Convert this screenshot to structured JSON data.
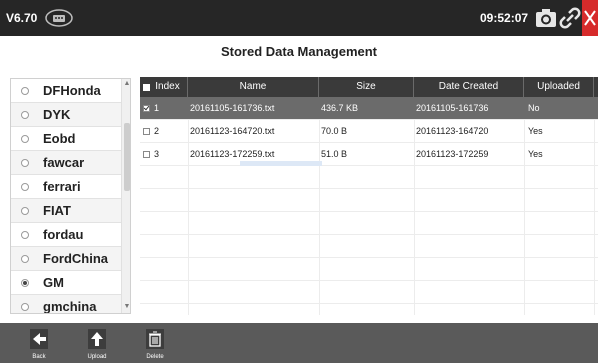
{
  "topbar": {
    "version": "V6.70",
    "time": "09:52:07",
    "icons": [
      "vci-connection-icon",
      "camera-icon",
      "link-icon",
      "close-icon"
    ]
  },
  "page": {
    "title": "Stored Data Management"
  },
  "vehicle_list": {
    "items": [
      {
        "label": "DFHonda",
        "selected": false
      },
      {
        "label": "DYK",
        "selected": false
      },
      {
        "label": "Eobd",
        "selected": false
      },
      {
        "label": "fawcar",
        "selected": false
      },
      {
        "label": "ferrari",
        "selected": false
      },
      {
        "label": "FIAT",
        "selected": false
      },
      {
        "label": "fordau",
        "selected": false
      },
      {
        "label": "FordChina",
        "selected": false
      },
      {
        "label": "GM",
        "selected": true
      },
      {
        "label": "gmchina",
        "selected": false
      }
    ]
  },
  "table": {
    "columns": [
      "Index",
      "Name",
      "Size",
      "Date Created",
      "Uploaded"
    ],
    "rows": [
      {
        "index": "1",
        "name": "20161105-161736.txt",
        "size": "436.7 KB",
        "date": "20161105-161736",
        "uploaded": "No",
        "checked": true,
        "selected": true
      },
      {
        "index": "2",
        "name": "20161123-164720.txt",
        "size": "70.0 B",
        "date": "20161123-164720",
        "uploaded": "Yes",
        "checked": false,
        "selected": false
      },
      {
        "index": "3",
        "name": "20161123-172259.txt",
        "size": "51.0 B",
        "date": "20161123-172259",
        "uploaded": "Yes",
        "checked": false,
        "selected": false
      }
    ]
  },
  "toolbar": {
    "back_label": "Back",
    "upload_label": "Upload",
    "delete_label": "Delete"
  },
  "colors": {
    "topbar": "#262626",
    "close": "#d62b2b",
    "header": "#3a3a3a",
    "selected_row": "#6b6b6b",
    "toolbar": "#5a5a5a"
  }
}
